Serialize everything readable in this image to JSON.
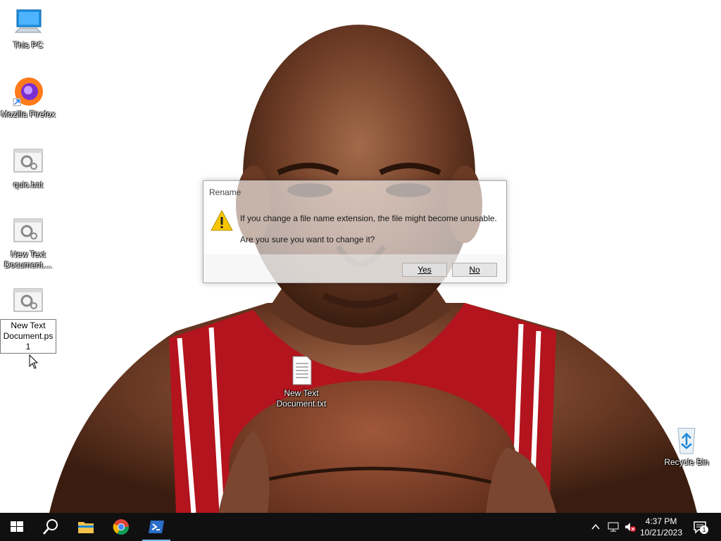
{
  "desktop": {
    "icons": [
      {
        "label": "This PC"
      },
      {
        "label": "Mozilla Firefox"
      },
      {
        "label": "quic.bat"
      },
      {
        "label": "New Text Document...."
      },
      {
        "label": "New Text Document.ps1"
      },
      {
        "label": "New Text Document.txt"
      },
      {
        "label": "Recycle Bin"
      }
    ]
  },
  "dialog": {
    "title": "Rename",
    "message": "If you change a file name extension, the file might become unusable.",
    "question": "Are you sure you want to change it?",
    "yes_label": "Yes",
    "no_label": "No"
  },
  "taskbar": {
    "clock_time": "4:37 PM",
    "clock_date": "10/21/2023",
    "notification_count": "1"
  },
  "colors": {
    "taskbar_bg": "#101010",
    "accent": "#0078d7",
    "warning": "#f7c600"
  }
}
